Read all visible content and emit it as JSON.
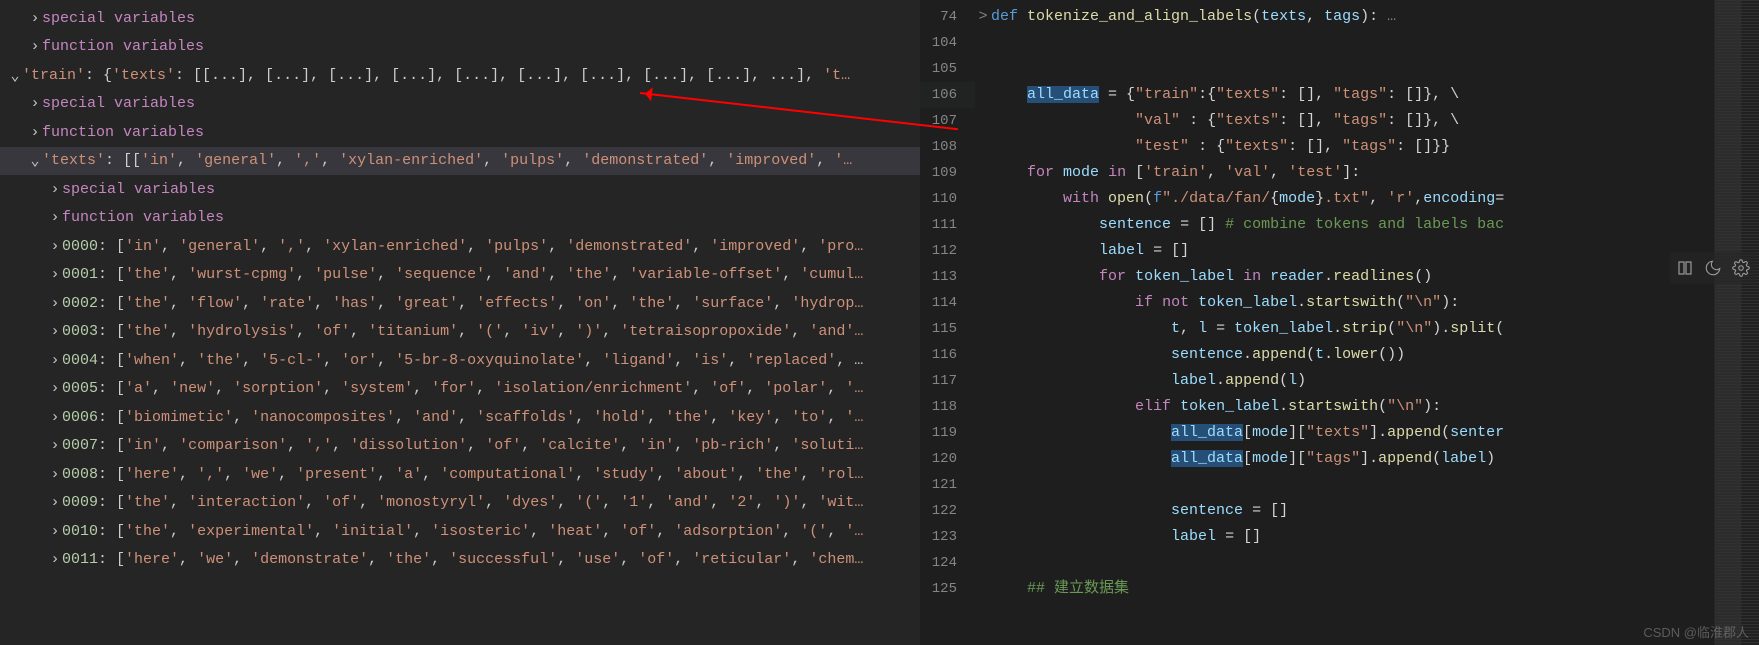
{
  "debug_panel": {
    "rows": [
      {
        "indent": 1,
        "expanded": false,
        "key_html": "<span class='key-purple'>special variables</span>"
      },
      {
        "indent": 1,
        "expanded": false,
        "key_html": "<span class='key-purple'>function variables</span>"
      },
      {
        "indent": 0,
        "expanded": true,
        "key_html": "<span class='str-orange'>'train'</span><span class='punct'>: {</span><span class='str-orange'>'texts'</span><span class='punct'>: [[...], [...], [...], [...], [...], [...], [...], [...], [...], ...], </span><span class='str-orange'>'t…</span>"
      },
      {
        "indent": 1,
        "expanded": false,
        "key_html": "<span class='key-purple'>special variables</span>"
      },
      {
        "indent": 1,
        "expanded": false,
        "key_html": "<span class='key-purple'>function variables</span>"
      },
      {
        "indent": 1,
        "expanded": true,
        "selected": true,
        "key_html": "<span class='str-orange'>'texts'</span><span class='punct'>: [[</span><span class='str-orange'>'in'</span><span class='punct'>, </span><span class='str-orange'>'general'</span><span class='punct'>, </span><span class='str-orange'>','</span><span class='punct'>, </span><span class='str-orange'>'xylan-enriched'</span><span class='punct'>, </span><span class='str-orange'>'pulps'</span><span class='punct'>, </span><span class='str-orange'>'demonstrated'</span><span class='punct'>, </span><span class='str-orange'>'improved'</span><span class='punct'>, </span><span class='str-orange'>'…</span>"
      },
      {
        "indent": 2,
        "expanded": false,
        "key_html": "<span class='key-purple'>special variables</span>"
      },
      {
        "indent": 2,
        "expanded": false,
        "key_html": "<span class='key-purple'>function variables</span>"
      },
      {
        "indent": 2,
        "expanded": false,
        "key_html": "<span class='num-teal'>0000</span><span class='punct'>: [</span><span class='str-orange'>'in'</span><span class='punct'>, </span><span class='str-orange'>'general'</span><span class='punct'>, </span><span class='str-orange'>','</span><span class='punct'>, </span><span class='str-orange'>'xylan-enriched'</span><span class='punct'>, </span><span class='str-orange'>'pulps'</span><span class='punct'>, </span><span class='str-orange'>'demonstrated'</span><span class='punct'>, </span><span class='str-orange'>'improved'</span><span class='punct'>, </span><span class='str-orange'>'pro…</span>"
      },
      {
        "indent": 2,
        "expanded": false,
        "key_html": "<span class='num-teal'>0001</span><span class='punct'>: [</span><span class='str-orange'>'the'</span><span class='punct'>, </span><span class='str-orange'>'wurst-cpmg'</span><span class='punct'>, </span><span class='str-orange'>'pulse'</span><span class='punct'>, </span><span class='str-orange'>'sequence'</span><span class='punct'>, </span><span class='str-orange'>'and'</span><span class='punct'>, </span><span class='str-orange'>'the'</span><span class='punct'>, </span><span class='str-orange'>'variable-offset'</span><span class='punct'>, </span><span class='str-orange'>'cumul…</span>"
      },
      {
        "indent": 2,
        "expanded": false,
        "key_html": "<span class='num-teal'>0002</span><span class='punct'>: [</span><span class='str-orange'>'the'</span><span class='punct'>, </span><span class='str-orange'>'flow'</span><span class='punct'>, </span><span class='str-orange'>'rate'</span><span class='punct'>, </span><span class='str-orange'>'has'</span><span class='punct'>, </span><span class='str-orange'>'great'</span><span class='punct'>, </span><span class='str-orange'>'effects'</span><span class='punct'>, </span><span class='str-orange'>'on'</span><span class='punct'>, </span><span class='str-orange'>'the'</span><span class='punct'>, </span><span class='str-orange'>'surface'</span><span class='punct'>, </span><span class='str-orange'>'hydrop…</span>"
      },
      {
        "indent": 2,
        "expanded": false,
        "key_html": "<span class='num-teal'>0003</span><span class='punct'>: [</span><span class='str-orange'>'the'</span><span class='punct'>, </span><span class='str-orange'>'hydrolysis'</span><span class='punct'>, </span><span class='str-orange'>'of'</span><span class='punct'>, </span><span class='str-orange'>'titanium'</span><span class='punct'>, </span><span class='str-orange'>'('</span><span class='punct'>, </span><span class='str-orange'>'iv'</span><span class='punct'>, </span><span class='str-orange'>')'</span><span class='punct'>, </span><span class='str-orange'>'tetraisopropoxide'</span><span class='punct'>, </span><span class='str-orange'>'and'…</span>"
      },
      {
        "indent": 2,
        "expanded": false,
        "key_html": "<span class='num-teal'>0004</span><span class='punct'>: [</span><span class='str-orange'>'when'</span><span class='punct'>, </span><span class='str-orange'>'the'</span><span class='punct'>, </span><span class='str-orange'>'5-cl-'</span><span class='punct'>, </span><span class='str-orange'>'or'</span><span class='punct'>, </span><span class='str-orange'>'5-br-8-oxyquinolate'</span><span class='punct'>, </span><span class='str-orange'>'ligand'</span><span class='punct'>, </span><span class='str-orange'>'is'</span><span class='punct'>, </span><span class='str-orange'>'replaced'</span><span class='punct'>, …</span>"
      },
      {
        "indent": 2,
        "expanded": false,
        "key_html": "<span class='num-teal'>0005</span><span class='punct'>: [</span><span class='str-orange'>'a'</span><span class='punct'>, </span><span class='str-orange'>'new'</span><span class='punct'>, </span><span class='str-orange'>'sorption'</span><span class='punct'>, </span><span class='str-orange'>'system'</span><span class='punct'>, </span><span class='str-orange'>'for'</span><span class='punct'>, </span><span class='str-orange'>'isolation/enrichment'</span><span class='punct'>, </span><span class='str-orange'>'of'</span><span class='punct'>, </span><span class='str-orange'>'polar'</span><span class='punct'>, </span><span class='str-orange'>'…</span>"
      },
      {
        "indent": 2,
        "expanded": false,
        "key_html": "<span class='num-teal'>0006</span><span class='punct'>: [</span><span class='str-orange'>'biomimetic'</span><span class='punct'>, </span><span class='str-orange'>'nanocomposites'</span><span class='punct'>, </span><span class='str-orange'>'and'</span><span class='punct'>, </span><span class='str-orange'>'scaffolds'</span><span class='punct'>, </span><span class='str-orange'>'hold'</span><span class='punct'>, </span><span class='str-orange'>'the'</span><span class='punct'>, </span><span class='str-orange'>'key'</span><span class='punct'>, </span><span class='str-orange'>'to'</span><span class='punct'>, </span><span class='str-orange'>'…</span>"
      },
      {
        "indent": 2,
        "expanded": false,
        "key_html": "<span class='num-teal'>0007</span><span class='punct'>: [</span><span class='str-orange'>'in'</span><span class='punct'>, </span><span class='str-orange'>'comparison'</span><span class='punct'>, </span><span class='str-orange'>','</span><span class='punct'>, </span><span class='str-orange'>'dissolution'</span><span class='punct'>, </span><span class='str-orange'>'of'</span><span class='punct'>, </span><span class='str-orange'>'calcite'</span><span class='punct'>, </span><span class='str-orange'>'in'</span><span class='punct'>, </span><span class='str-orange'>'pb-rich'</span><span class='punct'>, </span><span class='str-orange'>'soluti…</span>"
      },
      {
        "indent": 2,
        "expanded": false,
        "key_html": "<span class='num-teal'>0008</span><span class='punct'>: [</span><span class='str-orange'>'here'</span><span class='punct'>, </span><span class='str-orange'>','</span><span class='punct'>, </span><span class='str-orange'>'we'</span><span class='punct'>, </span><span class='str-orange'>'present'</span><span class='punct'>, </span><span class='str-orange'>'a'</span><span class='punct'>, </span><span class='str-orange'>'computational'</span><span class='punct'>, </span><span class='str-orange'>'study'</span><span class='punct'>, </span><span class='str-orange'>'about'</span><span class='punct'>, </span><span class='str-orange'>'the'</span><span class='punct'>, </span><span class='str-orange'>'rol…</span>"
      },
      {
        "indent": 2,
        "expanded": false,
        "key_html": "<span class='num-teal'>0009</span><span class='punct'>: [</span><span class='str-orange'>'the'</span><span class='punct'>, </span><span class='str-orange'>'interaction'</span><span class='punct'>, </span><span class='str-orange'>'of'</span><span class='punct'>, </span><span class='str-orange'>'monostyryl'</span><span class='punct'>, </span><span class='str-orange'>'dyes'</span><span class='punct'>, </span><span class='str-orange'>'('</span><span class='punct'>, </span><span class='str-orange'>'1'</span><span class='punct'>, </span><span class='str-orange'>'and'</span><span class='punct'>, </span><span class='str-orange'>'2'</span><span class='punct'>, </span><span class='str-orange'>')'</span><span class='punct'>, </span><span class='str-orange'>'wit…</span>"
      },
      {
        "indent": 2,
        "expanded": false,
        "key_html": "<span class='num-teal'>0010</span><span class='punct'>: [</span><span class='str-orange'>'the'</span><span class='punct'>, </span><span class='str-orange'>'experimental'</span><span class='punct'>, </span><span class='str-orange'>'initial'</span><span class='punct'>, </span><span class='str-orange'>'isosteric'</span><span class='punct'>, </span><span class='str-orange'>'heat'</span><span class='punct'>, </span><span class='str-orange'>'of'</span><span class='punct'>, </span><span class='str-orange'>'adsorption'</span><span class='punct'>, </span><span class='str-orange'>'('</span><span class='punct'>, </span><span class='str-orange'>'…</span>"
      },
      {
        "indent": 2,
        "expanded": false,
        "key_html": "<span class='num-teal'>0011</span><span class='punct'>: [</span><span class='str-orange'>'here'</span><span class='punct'>, </span><span class='str-orange'>'we'</span><span class='punct'>, </span><span class='str-orange'>'demonstrate'</span><span class='punct'>, </span><span class='str-orange'>'the'</span><span class='punct'>, </span><span class='str-orange'>'successful'</span><span class='punct'>, </span><span class='str-orange'>'use'</span><span class='punct'>, </span><span class='str-orange'>'of'</span><span class='punct'>, </span><span class='str-orange'>'reticular'</span><span class='punct'>, </span><span class='str-orange'>'chem…</span>"
      }
    ]
  },
  "editor": {
    "line_numbers": [
      74,
      104,
      105,
      106,
      107,
      108,
      109,
      110,
      111,
      112,
      113,
      114,
      115,
      116,
      117,
      118,
      119,
      120,
      121,
      122,
      123,
      124,
      125
    ],
    "lines": [
      {
        "fold": ">",
        "html": "<span class='py-kw'>def</span> <span class='py-fn'>tokenize_and_align_labels</span><span class='py-op'>(</span><span class='py-var'>texts</span><span class='py-op'>, </span><span class='py-var'>tags</span><span class='py-op'>):</span> <span class='c-gray'>…</span>"
      },
      {
        "html": ""
      },
      {
        "html": ""
      },
      {
        "hl": true,
        "html": "    <span class='py-var hl-word'>all_data</span> <span class='py-op'>= {</span><span class='py-str'>\"train\"</span><span class='py-op'>:{</span><span class='py-str'>\"texts\"</span><span class='py-op'>: [], </span><span class='py-str'>\"tags\"</span><span class='py-op'>: []}, \\</span>"
      },
      {
        "html": "                <span class='py-str'>\"val\"</span> <span class='py-op'>: {</span><span class='py-str'>\"texts\"</span><span class='py-op'>: [], </span><span class='py-str'>\"tags\"</span><span class='py-op'>: []}, \\</span>"
      },
      {
        "html": "                <span class='py-str'>\"test\"</span> <span class='py-op'>: {</span><span class='py-str'>\"texts\"</span><span class='py-op'>: [], </span><span class='py-str'>\"tags\"</span><span class='py-op'>: []}}</span>"
      },
      {
        "html": "    <span class='py-kw2'>for</span> <span class='py-var'>mode</span> <span class='py-kw2'>in</span> <span class='py-op'>[</span><span class='py-str'>'train'</span><span class='py-op'>, </span><span class='py-str'>'val'</span><span class='py-op'>, </span><span class='py-str'>'test'</span><span class='py-op'>]:</span>"
      },
      {
        "html": "        <span class='py-kw2'>with</span> <span class='py-fn'>open</span><span class='py-op'>(</span><span class='py-kw'>f</span><span class='py-str'>\"./data/fan/</span><span class='py-op'>{</span><span class='py-var'>mode</span><span class='py-op'>}</span><span class='py-str'>.txt\"</span><span class='py-op'>, </span><span class='py-str'>'r'</span><span class='py-op'>,</span><span class='py-var'>encoding</span><span class='py-op'>=</span>"
      },
      {
        "html": "            <span class='py-var'>sentence</span> <span class='py-op'>= []</span> <span class='py-cm'># combine tokens and labels bac</span>"
      },
      {
        "html": "            <span class='py-var'>label</span> <span class='py-op'>= []</span>"
      },
      {
        "html": "            <span class='py-kw2'>for</span> <span class='py-var'>token_label</span> <span class='py-kw2'>in</span> <span class='py-var'>reader</span><span class='py-op'>.</span><span class='py-fn'>readlines</span><span class='py-op'>()</span>"
      },
      {
        "html": "                <span class='py-kw2'>if</span> <span class='py-kw2'>not</span> <span class='py-var'>token_label</span><span class='py-op'>.</span><span class='py-fn'>startswith</span><span class='py-op'>(</span><span class='py-str'>\"\\n\"</span><span class='py-op'>):</span>"
      },
      {
        "html": "                    <span class='py-var'>t</span><span class='py-op'>, </span><span class='py-var'>l</span> <span class='py-op'>= </span><span class='py-var'>token_label</span><span class='py-op'>.</span><span class='py-fn'>strip</span><span class='py-op'>(</span><span class='py-str'>\"\\n\"</span><span class='py-op'>).</span><span class='py-fn'>split</span><span class='py-op'>(</span>"
      },
      {
        "html": "                    <span class='py-var'>sentence</span><span class='py-op'>.</span><span class='py-fn'>append</span><span class='py-op'>(</span><span class='py-var'>t</span><span class='py-op'>.</span><span class='py-fn'>lower</span><span class='py-op'>())</span>"
      },
      {
        "html": "                    <span class='py-var'>label</span><span class='py-op'>.</span><span class='py-fn'>append</span><span class='py-op'>(</span><span class='py-var'>l</span><span class='py-op'>)</span>"
      },
      {
        "html": "                <span class='py-kw2'>elif</span> <span class='py-var'>token_label</span><span class='py-op'>.</span><span class='py-fn'>startswith</span><span class='py-op'>(</span><span class='py-str'>\"\\n\"</span><span class='py-op'>):</span>"
      },
      {
        "html": "                    <span class='py-var hl-word'>all_data</span><span class='py-op'>[</span><span class='py-var'>mode</span><span class='py-op'>][</span><span class='py-str'>\"texts\"</span><span class='py-op'>].</span><span class='py-fn'>append</span><span class='py-op'>(</span><span class='py-var'>senter</span>"
      },
      {
        "html": "                    <span class='py-var hl-word'>all_data</span><span class='py-op'>[</span><span class='py-var'>mode</span><span class='py-op'>][</span><span class='py-str'>\"tags\"</span><span class='py-op'>].</span><span class='py-fn'>append</span><span class='py-op'>(</span><span class='py-var'>label</span><span class='py-op'>)</span>"
      },
      {
        "html": ""
      },
      {
        "html": "                    <span class='py-var'>sentence</span> <span class='py-op'>= []</span>"
      },
      {
        "html": "                    <span class='py-var'>label</span> <span class='py-op'>= []</span>"
      },
      {
        "html": ""
      },
      {
        "html": "    <span class='py-cm'>## 建立数据集</span>"
      }
    ]
  },
  "watermark": "CSDN @临淮郡人"
}
